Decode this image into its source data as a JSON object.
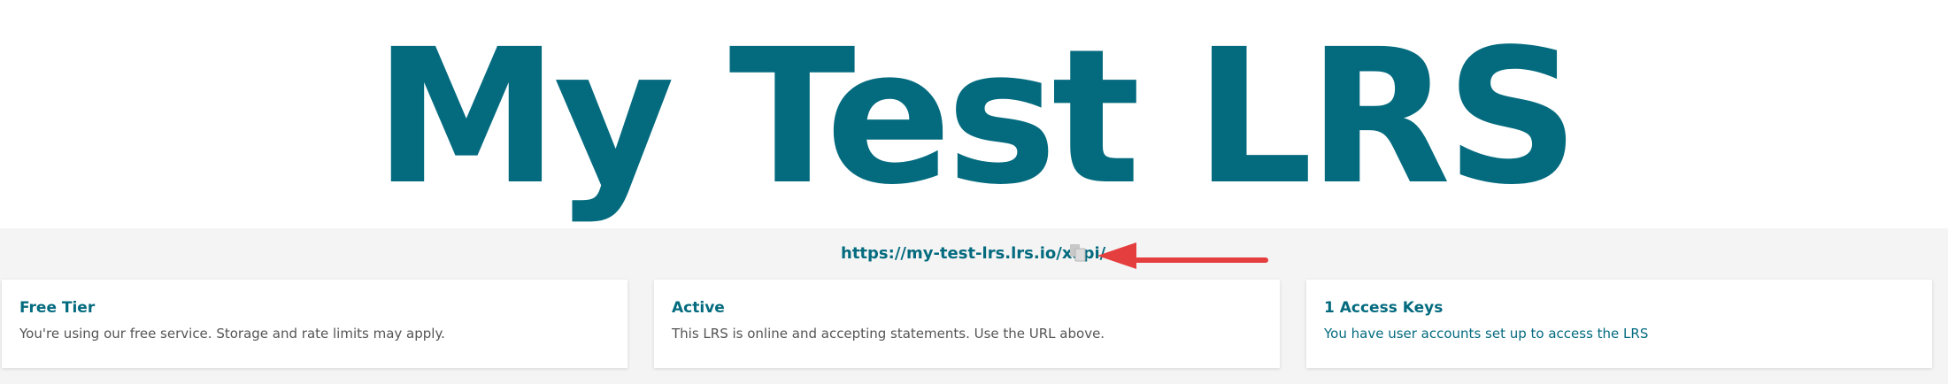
{
  "header": {
    "title": "My Test LRS"
  },
  "endpoint": {
    "url": "https://my-test-lrs.lrs.io/xapi/",
    "copy_icon": "copy-icon"
  },
  "annotation": {
    "arrow_color": "#e53e3e"
  },
  "colors": {
    "brand": "#046b7f",
    "background": "#f4f4f4",
    "card_text": "#555555"
  },
  "cards": [
    {
      "title": "Free Tier",
      "text": "You're using our free service. Storage and rate limits may apply."
    },
    {
      "title": "Active",
      "text": "This LRS is online and accepting statements. Use the URL above."
    },
    {
      "title": "1 Access Keys",
      "text": "You have user accounts set up to access the LRS"
    }
  ]
}
